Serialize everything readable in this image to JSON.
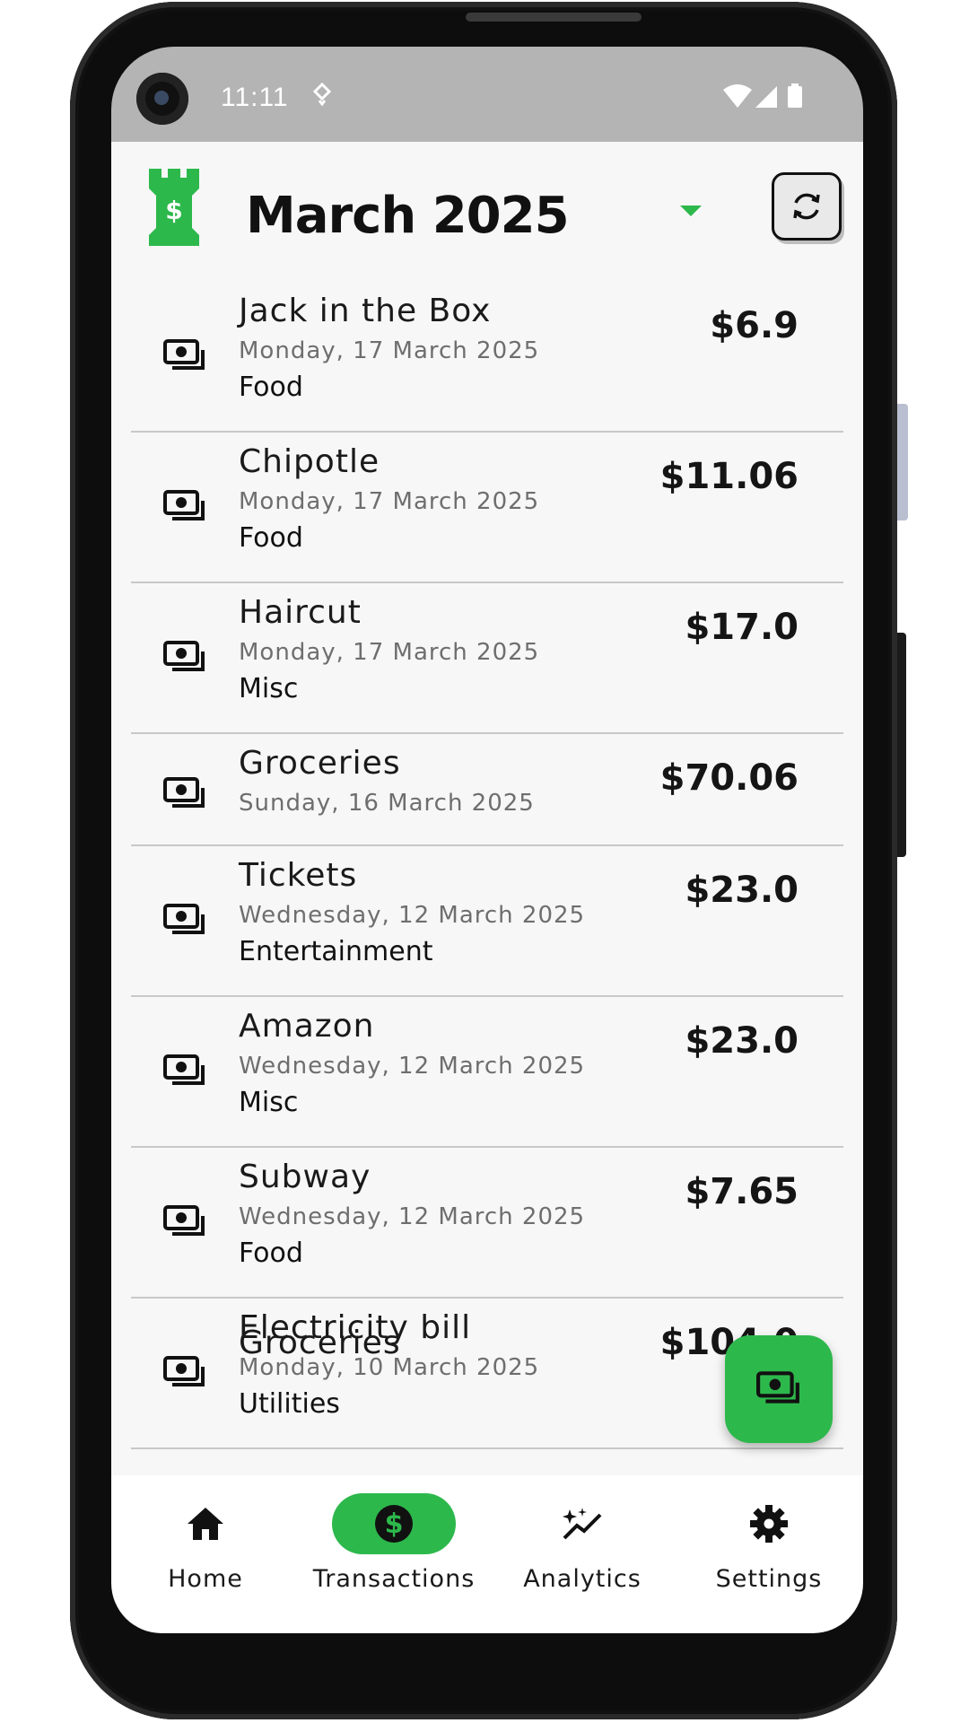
{
  "status_bar": {
    "time": "11:11"
  },
  "header": {
    "month": "March 2025"
  },
  "transactions": [
    {
      "name": "Jack in the Box",
      "date": "Monday, 17 March 2025",
      "category": "Food",
      "amount": "$6.9"
    },
    {
      "name": "Chipotle",
      "date": "Monday, 17 March 2025",
      "category": "Food",
      "amount": "$11.06"
    },
    {
      "name": "Haircut",
      "date": "Monday, 17 March 2025",
      "category": "Misc",
      "amount": "$17.0"
    },
    {
      "name": "Groceries",
      "date": "Sunday, 16 March 2025",
      "category": "",
      "amount": "$70.06"
    },
    {
      "name": "Tickets",
      "date": "Wednesday, 12 March 2025",
      "category": "Entertainment",
      "amount": "$23.0"
    },
    {
      "name": "Amazon",
      "date": "Wednesday, 12 March 2025",
      "category": "Misc",
      "amount": "$23.0"
    },
    {
      "name": "Subway",
      "date": "Wednesday, 12 March 2025",
      "category": "Food",
      "amount": "$7.65"
    },
    {
      "name": "Electricity bill",
      "date": "Monday, 10 March 2025",
      "category": "Utilities",
      "amount": "$104.0"
    }
  ],
  "partial_row": {
    "name": "Groceries"
  },
  "nav": {
    "items": [
      {
        "label": "Home",
        "icon": "home-icon"
      },
      {
        "label": "Transactions",
        "icon": "dollar-circle-icon"
      },
      {
        "label": "Analytics",
        "icon": "sparkle-trend-icon"
      },
      {
        "label": "Settings",
        "icon": "gear-icon"
      }
    ],
    "active_index": 1
  },
  "colors": {
    "accent": "#2db84c",
    "status_bar": "#b4b4b4",
    "background": "#f7f7f7"
  }
}
